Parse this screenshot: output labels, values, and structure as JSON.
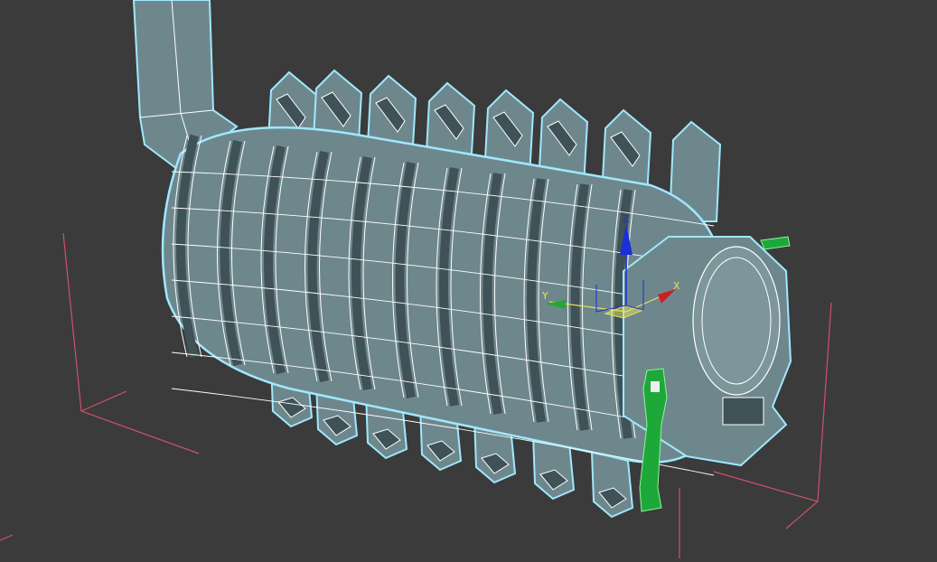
{
  "viewport": {
    "gizmo": {
      "x_label": "X",
      "y_label": "Y",
      "z_label": "Z"
    }
  },
  "colors": {
    "background": "#3b3b3b",
    "mesh_fill": "#6e878d",
    "mesh_dark": "#3e5257",
    "wire": "#ffffff",
    "outline": "#9fe8ff",
    "bbox": "#d0506a",
    "handle": "#1fa83a",
    "axis_x": "#cc2020",
    "axis_y": "#1faa30",
    "axis_z": "#1b2fd8"
  }
}
